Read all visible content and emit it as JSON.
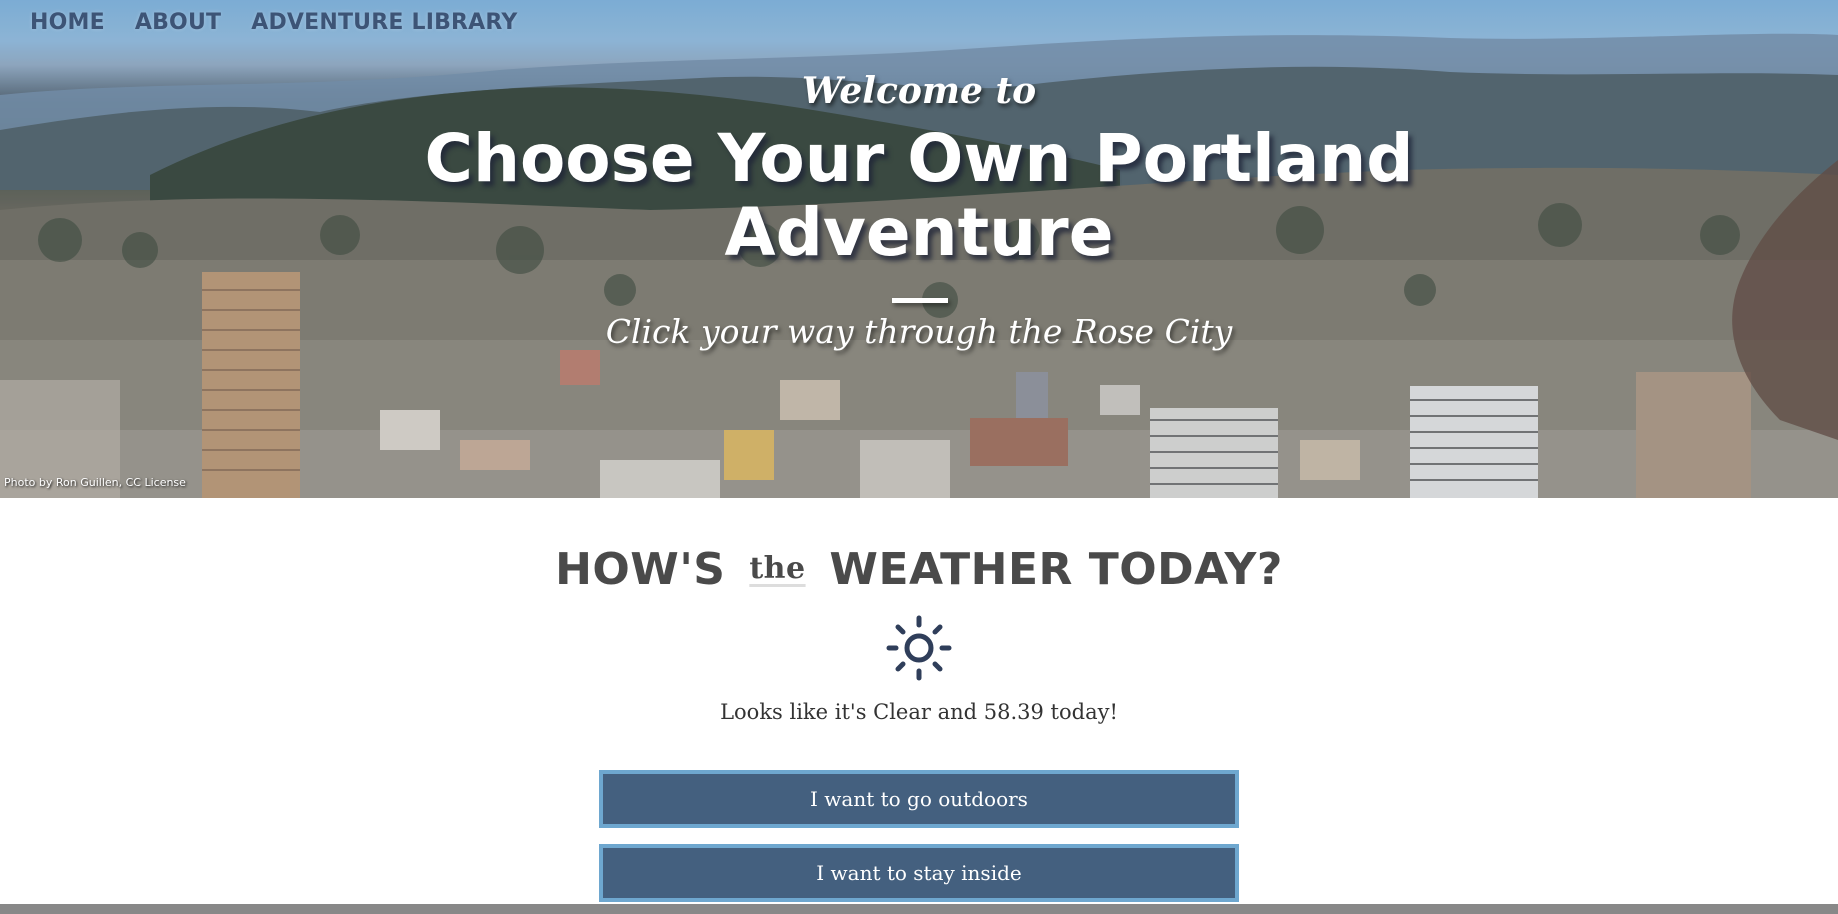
{
  "nav": {
    "items": [
      {
        "label": "HOME"
      },
      {
        "label": "ABOUT"
      },
      {
        "label": "ADVENTURE LIBRARY"
      }
    ]
  },
  "hero": {
    "welcome": "Welcome to",
    "title_line1": "Choose Your Own Portland",
    "title_line2": "Adventure",
    "subtitle": "Click your way through the Rose City",
    "photo_credit": "Photo by Ron Guillen, CC License"
  },
  "weather": {
    "heading_before": "HOW'S",
    "heading_the": "the",
    "heading_after": "WEATHER TODAY?",
    "icon": "sun-icon",
    "status_text": "Looks like it's Clear and 58.39 today!",
    "buttons": [
      {
        "label": "I want to go outdoors"
      },
      {
        "label": "I want to stay inside"
      }
    ]
  },
  "colors": {
    "nav_text": "#3d5476",
    "button_bg": "#44607f",
    "button_border": "#6ea7cf",
    "heading_text": "#4a4a4a",
    "sun_icon": "#2f3e5a"
  }
}
